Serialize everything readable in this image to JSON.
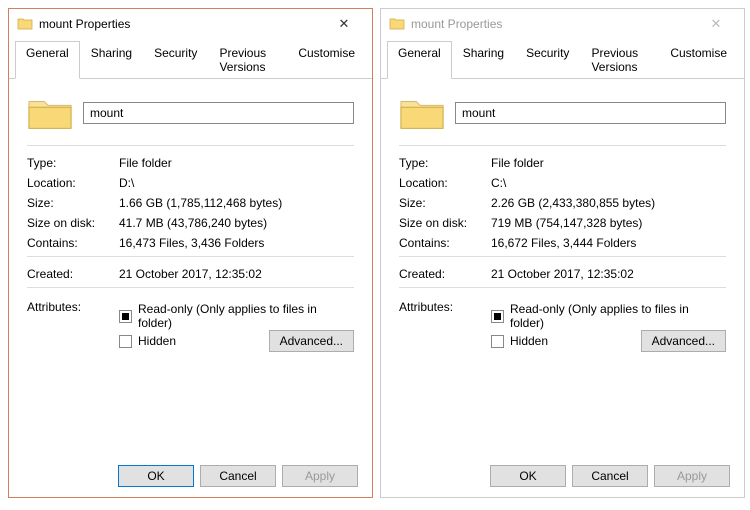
{
  "left": {
    "title": "mount Properties",
    "tabs": {
      "general": "General",
      "sharing": "Sharing",
      "security": "Security",
      "previous": "Previous Versions",
      "customise": "Customise"
    },
    "name": "mount",
    "type_label": "Type:",
    "type": "File folder",
    "location_label": "Location:",
    "location": "D:\\",
    "size_label": "Size:",
    "size": "1.66 GB (1,785,112,468 bytes)",
    "sizeondisk_label": "Size on disk:",
    "sizeondisk": "41.7 MB (43,786,240 bytes)",
    "contains_label": "Contains:",
    "contains": "16,473 Files, 3,436 Folders",
    "created_label": "Created:",
    "created": "21 October 2017, 12:35:02",
    "attributes_label": "Attributes:",
    "readonly_label": "Read-only (Only applies to files in folder)",
    "hidden_label": "Hidden",
    "advanced": "Advanced...",
    "ok": "OK",
    "cancel": "Cancel",
    "apply": "Apply"
  },
  "right": {
    "title": "mount Properties",
    "tabs": {
      "general": "General",
      "sharing": "Sharing",
      "security": "Security",
      "previous": "Previous Versions",
      "customise": "Customise"
    },
    "name": "mount",
    "type_label": "Type:",
    "type": "File folder",
    "location_label": "Location:",
    "location": "C:\\",
    "size_label": "Size:",
    "size": "2.26 GB (2,433,380,855 bytes)",
    "sizeondisk_label": "Size on disk:",
    "sizeondisk": "719 MB (754,147,328 bytes)",
    "contains_label": "Contains:",
    "contains": "16,672 Files, 3,444 Folders",
    "created_label": "Created:",
    "created": "21 October 2017, 12:35:02",
    "attributes_label": "Attributes:",
    "readonly_label": "Read-only (Only applies to files in folder)",
    "hidden_label": "Hidden",
    "advanced": "Advanced...",
    "ok": "OK",
    "cancel": "Cancel",
    "apply": "Apply"
  }
}
